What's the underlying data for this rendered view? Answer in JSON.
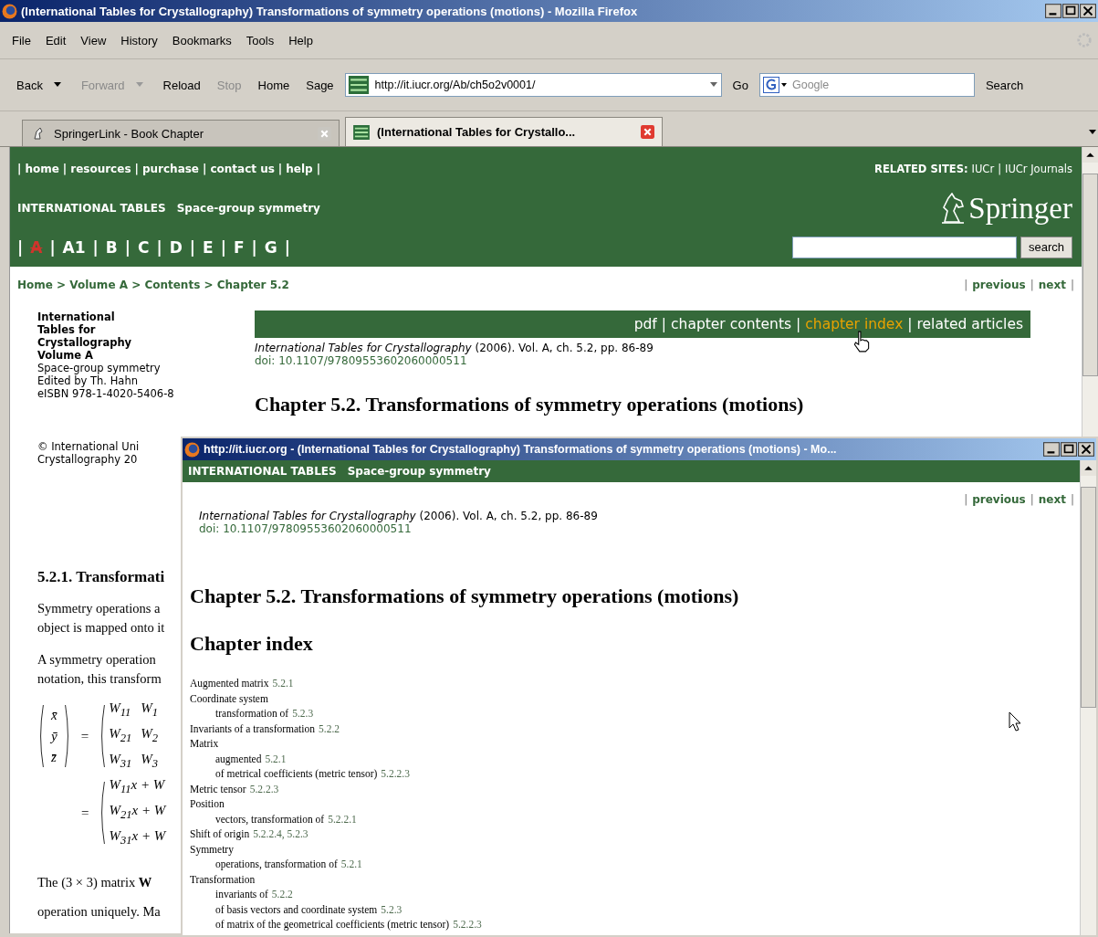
{
  "window": {
    "title": "(International Tables for Crystallography) Transformations of symmetry operations (motions) - Mozilla Firefox"
  },
  "menu": [
    {
      "label": "File"
    },
    {
      "label": "Edit"
    },
    {
      "label": "View"
    },
    {
      "label": "History"
    },
    {
      "label": "Bookmarks"
    },
    {
      "label": "Tools"
    },
    {
      "label": "Help"
    }
  ],
  "toolbar": {
    "buttons": [
      {
        "label": "Back",
        "disabled": false,
        "dropdown": true
      },
      {
        "label": "Forward",
        "disabled": true,
        "dropdown": true
      },
      {
        "label": "Reload",
        "disabled": false,
        "dropdown": false
      },
      {
        "label": "Stop",
        "disabled": true,
        "dropdown": false
      },
      {
        "label": "Home",
        "disabled": false,
        "dropdown": false
      },
      {
        "label": "Sage",
        "disabled": false,
        "dropdown": false
      }
    ],
    "url": "http://it.iucr.org/Ab/ch5o2v0001/",
    "go": "Go",
    "search_placeholder": "Google",
    "search_button": "Search"
  },
  "tabs": [
    {
      "label": "SpringerLink - Book Chapter",
      "selected": false
    },
    {
      "label": "(International Tables for Crystallo...",
      "selected": true
    }
  ],
  "page": {
    "separator": "|",
    "top_links": [
      {
        "label": "home"
      },
      {
        "label": "resources"
      },
      {
        "label": "purchase"
      },
      {
        "label": "contact us"
      },
      {
        "label": "help"
      }
    ],
    "related_label": "RELATED SITES:",
    "related": [
      {
        "label": "IUCr"
      },
      {
        "label": "IUCr Journals"
      }
    ],
    "series": "INTERNATIONAL TABLES",
    "subtitle": "Space-group symmetry",
    "logo": "Springer",
    "volumes": [
      {
        "label": "A",
        "selected": true
      },
      {
        "label": "A1",
        "selected": false
      },
      {
        "label": "B",
        "selected": false
      },
      {
        "label": "C",
        "selected": false
      },
      {
        "label": "D",
        "selected": false
      },
      {
        "label": "E",
        "selected": false
      },
      {
        "label": "F",
        "selected": false
      },
      {
        "label": "G",
        "selected": false
      }
    ],
    "search_button": "search",
    "breadcrumb": "Home > Volume A > Contents > Chapter 5.2",
    "prev": "previous",
    "next": "next",
    "book": {
      "title_lines": [
        "International",
        "Tables for",
        "Crystallography",
        "Volume A"
      ],
      "lines": [
        "Space-group symmetry",
        "Edited by Th. Hahn",
        "eISBN 978-1-4020-5406-8"
      ]
    },
    "chapter_links": [
      {
        "label": "pdf",
        "hovered": false
      },
      {
        "label": "chapter contents",
        "hovered": false
      },
      {
        "label": "chapter index",
        "hovered": true
      },
      {
        "label": "related articles",
        "hovered": false
      }
    ],
    "citation": "*International Tables for Crystallography* (2006). Vol. A, ch. 5.2, pp. 86-89",
    "doi": "doi: 10.1107/97809553602060000511",
    "heading": "Chapter 5.2. Transformations of symmetry operations (motions)",
    "copyright": [
      "© International Uni",
      "Crystallography 20"
    ],
    "section": "5.2.1. Transformati",
    "paragraphs": [
      [
        "Symmetry operations a",
        "object is mapped onto it"
      ],
      [
        "A symmetry operation",
        "notation, this transform"
      ]
    ],
    "matrix": {
      "left": [
        "x̄",
        "ȳ",
        "z̄"
      ],
      "equals": "=",
      "rows": [
        [
          "W$_{11}$",
          "W$_{1}$"
        ],
        [
          "W$_{21}$",
          "W$_{2}$"
        ],
        [
          "W$_{31}$",
          "W$_{3}$"
        ]
      ],
      "rows2": [
        "W$_{11}$x + W",
        "W$_{21}$x + W",
        "W$_{31}$x + W"
      ]
    },
    "after": [
      "The (3 × 3) matrix **W**",
      "operation uniquely. Ma"
    ]
  },
  "popup": {
    "title": "http://it.iucr.org - (International Tables for Crystallography) Transformations of symmetry operations (motions) - Mo...",
    "series": "INTERNATIONAL TABLES",
    "subtitle": "Space-group symmetry",
    "prev": "previous",
    "next": "next",
    "separator": "|",
    "citation": "*International Tables for Crystallography* (2006). Vol. A, ch. 5.2, pp. 86-89",
    "doi": "doi: 10.1107/97809553602060000511",
    "heading": "Chapter 5.2. Transformations of symmetry operations (motions)",
    "index_heading": "Chapter index",
    "index": [
      {
        "term": "Augmented matrix",
        "refs": "5.2.1"
      },
      {
        "term": "Coordinate system",
        "children": [
          {
            "term": "transformation of",
            "refs": "5.2.3"
          }
        ]
      },
      {
        "term": "Invariants of a transformation",
        "refs": "5.2.2"
      },
      {
        "term": "Matrix",
        "children": [
          {
            "term": "augmented",
            "refs": "5.2.1"
          },
          {
            "term": "of metrical coefficients (metric tensor)",
            "refs": "5.2.2.3"
          }
        ]
      },
      {
        "term": "Metric tensor",
        "refs": "5.2.2.3"
      },
      {
        "term": "Position",
        "children": [
          {
            "term": "vectors, transformation of",
            "refs": "5.2.2.1"
          }
        ]
      },
      {
        "term": "Shift of origin",
        "refs": "5.2.2.4, 5.2.3"
      },
      {
        "term": "Symmetry",
        "children": [
          {
            "term": "operations, transformation of",
            "refs": "5.2.1"
          }
        ]
      },
      {
        "term": "Transformation",
        "children": [
          {
            "term": "invariants of",
            "refs": "5.2.2"
          },
          {
            "term": "of basis vectors and coordinate system",
            "refs": "5.2.3"
          },
          {
            "term": "of matrix of the geometrical coefficients (metric tensor)",
            "refs": "5.2.2.3"
          }
        ]
      }
    ]
  }
}
